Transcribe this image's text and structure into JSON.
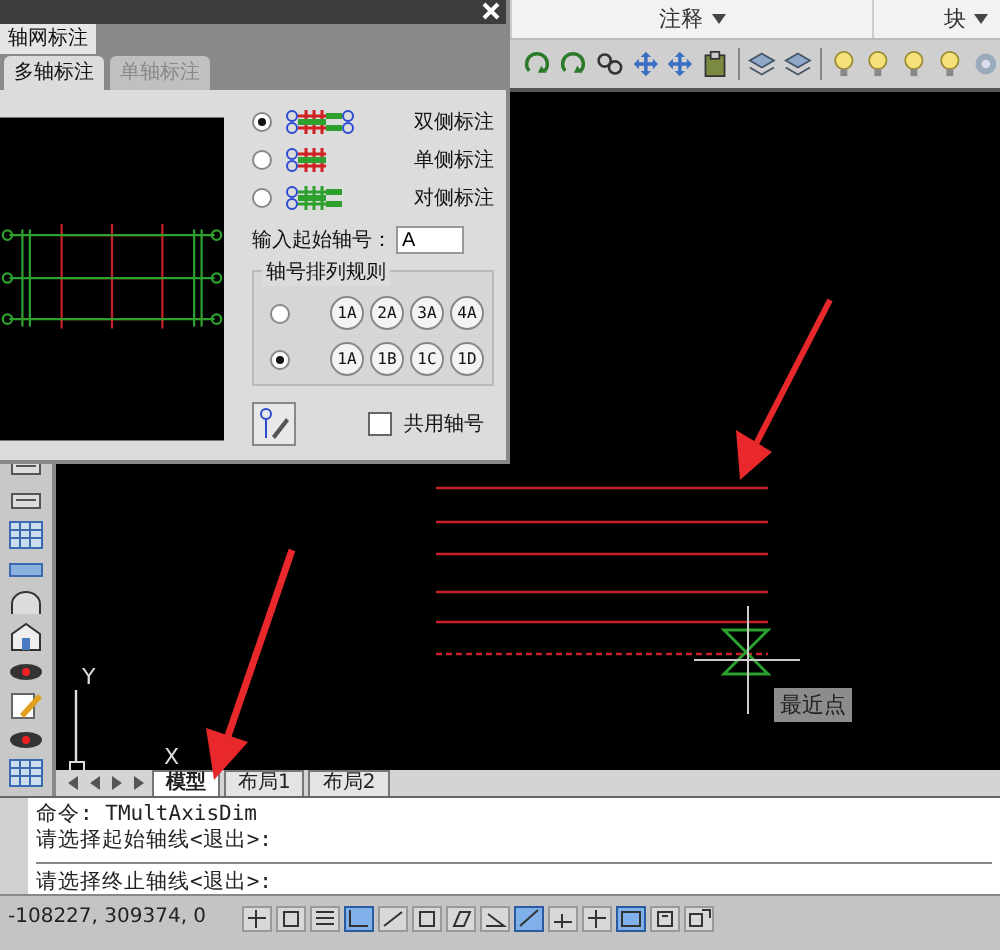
{
  "ribbon": {
    "panels": [
      {
        "label": "注释"
      },
      {
        "label": "块"
      }
    ]
  },
  "dialog": {
    "title": "轴网标注",
    "tabs": [
      {
        "label": "多轴标注",
        "selected": true
      },
      {
        "label": "单轴标注",
        "selected": false
      }
    ],
    "styles": [
      {
        "label": "双侧标注",
        "selected": true,
        "kind": "double"
      },
      {
        "label": "单侧标注",
        "selected": false,
        "kind": "single"
      },
      {
        "label": "对侧标注",
        "selected": false,
        "kind": "opposite"
      }
    ],
    "start_label": "输入起始轴号：",
    "start_value": "A",
    "rule_group": {
      "title": "轴号排列规则",
      "rules": [
        {
          "selected": false,
          "bubbles": [
            "1A",
            "2A",
            "3A",
            "4A"
          ]
        },
        {
          "selected": true,
          "bubbles": [
            "1A",
            "1B",
            "1C",
            "1D"
          ]
        }
      ]
    },
    "shared": {
      "label": "共用轴号",
      "checked": false
    }
  },
  "canvas": {
    "tooltip": "最近点",
    "ucs": {
      "x": "X",
      "y": "Y"
    },
    "layout_tabs": [
      {
        "label": "模型",
        "selected": true
      },
      {
        "label": "布局1",
        "selected": false
      },
      {
        "label": "布局2",
        "selected": false
      }
    ]
  },
  "command": {
    "history": [
      "命令: TMultAxisDim",
      "请选择起始轴线<退出>:"
    ],
    "prompt": "请选择终止轴线<退出>:"
  },
  "status_bar": {
    "coordinates": "-108227, 309374, 0",
    "toggles": [
      {
        "on": false
      },
      {
        "on": false
      },
      {
        "on": false
      },
      {
        "on": true
      },
      {
        "on": false
      },
      {
        "on": false
      },
      {
        "on": false
      },
      {
        "on": false
      },
      {
        "on": true
      },
      {
        "on": false
      },
      {
        "on": false
      },
      {
        "on": true
      },
      {
        "on": false
      },
      {
        "on": false
      }
    ]
  }
}
